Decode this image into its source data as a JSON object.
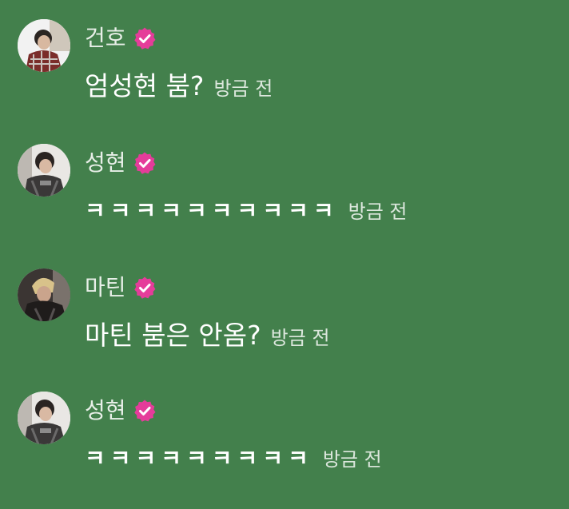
{
  "comments": [
    {
      "author": "건호",
      "verified": true,
      "text": "엄성현 붐?",
      "time": "방금 전",
      "avatar_icon": "person-photo-plaid-shirt",
      "style": "normal"
    },
    {
      "author": "성현",
      "verified": true,
      "text": "ㅋㅋㅋㅋㅋㅋㅋㅋㅋㅋ",
      "time": "방금 전",
      "avatar_icon": "person-photo-jacket",
      "style": "laugh"
    },
    {
      "author": "마틴",
      "verified": true,
      "text": "마틴 붐은 안옴?",
      "time": "방금 전",
      "avatar_icon": "person-photo-blonde-hair",
      "style": "normal"
    },
    {
      "author": "성현",
      "verified": true,
      "text": "ㅋㅋㅋㅋㅋㅋㅋㅋㅋ",
      "time": "방금 전",
      "avatar_icon": "person-photo-jacket",
      "style": "laugh"
    }
  ],
  "colors": {
    "background": "#43804c",
    "badge": "#e53c9a",
    "text": "#ffffff",
    "muted_text": "#dce7dd"
  }
}
